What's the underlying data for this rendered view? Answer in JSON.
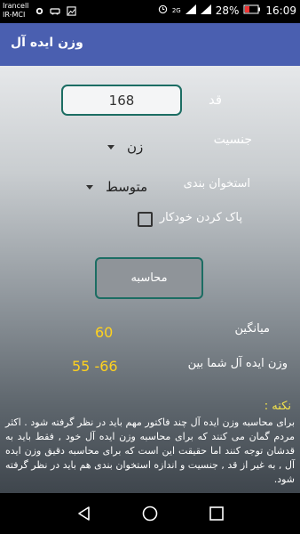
{
  "status_bar": {
    "carrier_line1": "Irancell",
    "carrier_line2": "IR-MCI",
    "network": "2G",
    "battery": "28%",
    "time": "16:09"
  },
  "app_bar": {
    "title": "وزن ایده آل"
  },
  "form": {
    "height_label": "قد",
    "height_value": "168",
    "gender_label": "جنسیت",
    "gender_value": "زن",
    "bone_label": "استخوان بندی",
    "bone_value": "متوسط",
    "autoclear_label": "پاک کردن خودکار",
    "autoclear_checked": false,
    "calculate_label": "محاسبه"
  },
  "results": {
    "average_label": "میانگین",
    "average_value": "60",
    "ideal_label": "وزن ایده آل شما بین",
    "ideal_value": "55 -66"
  },
  "note": {
    "title": "نکته :",
    "text": "برای محاسبه وزن ایده آل چند فاکتور مهم باید در نظر گرفته شود . اکثر مردم گمان می کنند که برای محاسبه وزن ایده آل خود , فقط باید به قدشان توجه کنند اما حقیقت این است که برای محاسبه دقیق وزن ایده آل , به غیر از قد , جنسیت و اندازه استخوان بندی هم باید در نظر گرفته شود."
  },
  "colors": {
    "app_bar": "#4a5fb0",
    "accent": "#1c6d63",
    "result": "#ffd21e",
    "note_title": "#f3e34b"
  }
}
